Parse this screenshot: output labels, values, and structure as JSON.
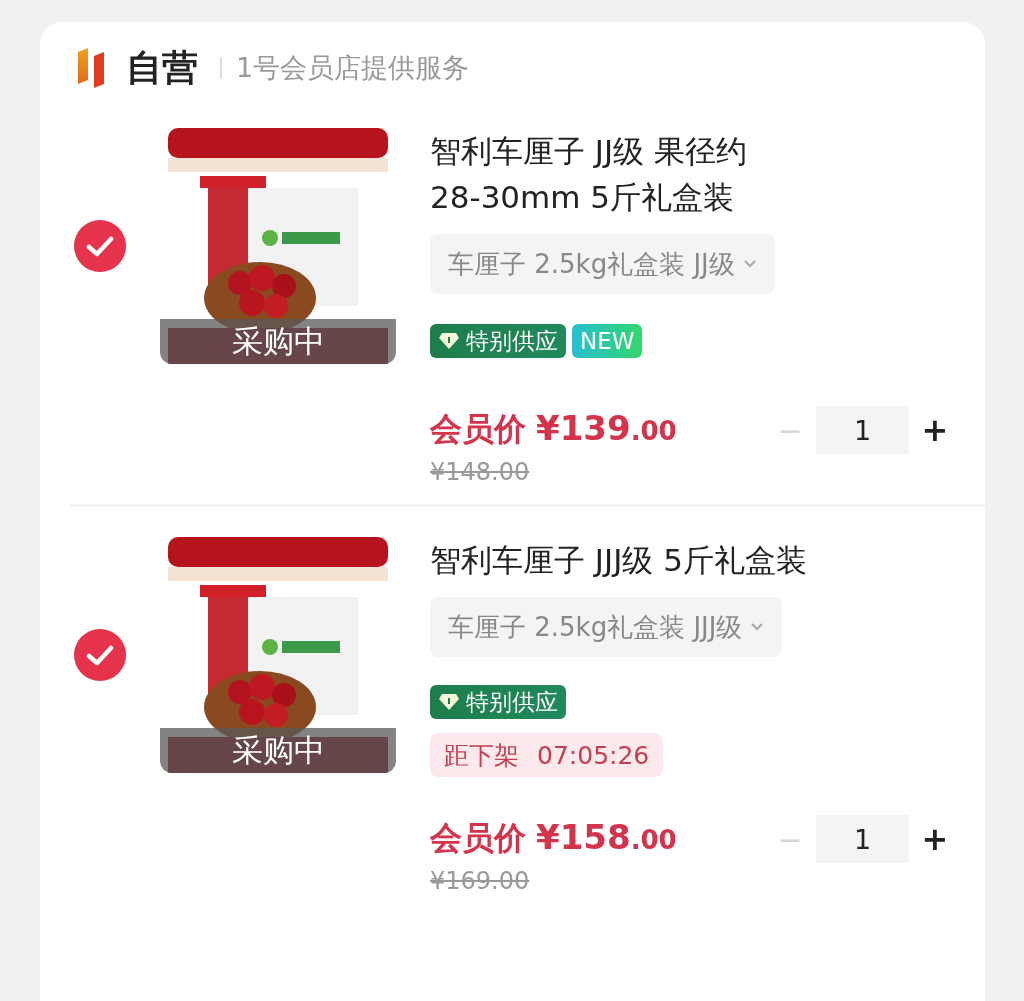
{
  "header": {
    "badge": "自营",
    "provider": "1号会员店提供服务"
  },
  "items": [
    {
      "selected": true,
      "image": {
        "kind": "picture",
        "overlay": "采购中"
      },
      "title": "智利车厘子 JJ级  果径约\n28-30mm 5斤礼盒装",
      "variant": "车厘子 2.5kg礼盒装 JJ级",
      "tags": [
        {
          "kind": "special",
          "label": "特别供应"
        },
        {
          "kind": "new",
          "label": "NEW"
        }
      ],
      "price_label": "会员价",
      "price_int": "¥139",
      "price_dec": ".00",
      "original_price": "¥148.00",
      "minus": "−",
      "minus_disabled": true,
      "quantity": "1",
      "plus": "+"
    },
    {
      "selected": true,
      "image": {
        "kind": "picture",
        "overlay": "采购中"
      },
      "title": "智利车厘子 JJJ级 5斤礼盒装",
      "variant": "车厘子 2.5kg礼盒装 JJJ级",
      "tags": [
        {
          "kind": "special",
          "label": "特别供应"
        }
      ],
      "countdown": {
        "label": "距下架",
        "time": "07:05:26"
      },
      "price_label": "会员价",
      "price_int": "¥158",
      "price_dec": ".00",
      "original_price": "¥169.00",
      "minus": "−",
      "minus_disabled": true,
      "quantity": "1",
      "plus": "+"
    }
  ]
}
